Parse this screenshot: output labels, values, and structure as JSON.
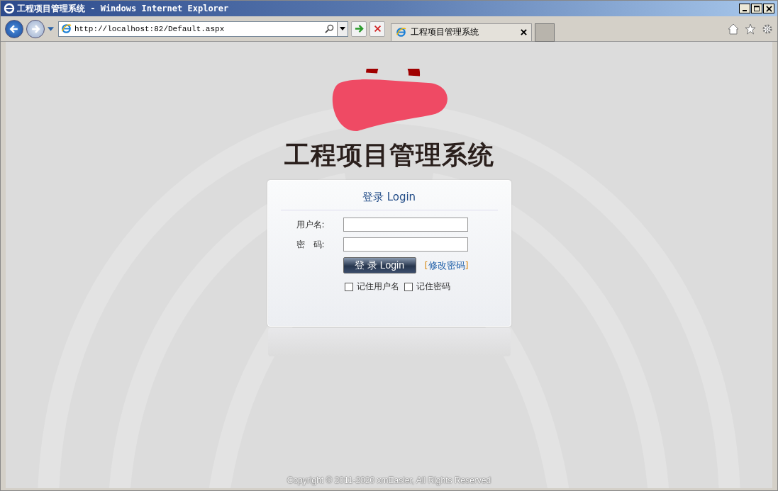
{
  "window": {
    "title": "工程项目管理系统 - Windows Internet Explorer"
  },
  "address_bar": {
    "url": "http://localhost:82/Default.aspx"
  },
  "tabs": [
    {
      "title": "工程项目管理系统",
      "selected": true
    }
  ],
  "page": {
    "heading": "工程项目管理系统",
    "login": {
      "title": "登录 Login",
      "fields": [
        {
          "label": "用户名:"
        },
        {
          "label": "密　码:"
        }
      ],
      "button": "登 录 Login",
      "link": {
        "open": "[",
        "text": "修改密码",
        "close": "]"
      },
      "checkboxes": [
        {
          "label": "记住用户名",
          "checked": false
        },
        {
          "label": "记住密码",
          "checked": false
        }
      ]
    },
    "footer": "Copyright © 2011-2020 xmEasier, All Rights Reserved"
  }
}
